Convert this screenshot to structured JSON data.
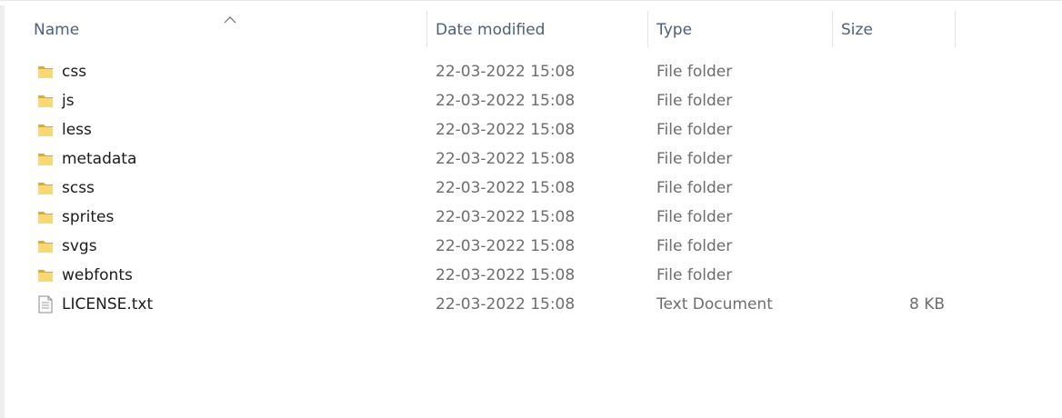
{
  "columns": {
    "name": "Name",
    "date_modified": "Date modified",
    "type": "Type",
    "size": "Size"
  },
  "sort": {
    "column": "name",
    "direction": "ascending"
  },
  "files": [
    {
      "name": "css",
      "date_modified": "22-03-2022 15:08",
      "type": "File folder",
      "size": "",
      "icon": "folder-icon"
    },
    {
      "name": "js",
      "date_modified": "22-03-2022 15:08",
      "type": "File folder",
      "size": "",
      "icon": "folder-icon"
    },
    {
      "name": "less",
      "date_modified": "22-03-2022 15:08",
      "type": "File folder",
      "size": "",
      "icon": "folder-icon"
    },
    {
      "name": "metadata",
      "date_modified": "22-03-2022 15:08",
      "type": "File folder",
      "size": "",
      "icon": "folder-icon"
    },
    {
      "name": "scss",
      "date_modified": "22-03-2022 15:08",
      "type": "File folder",
      "size": "",
      "icon": "folder-icon"
    },
    {
      "name": "sprites",
      "date_modified": "22-03-2022 15:08",
      "type": "File folder",
      "size": "",
      "icon": "folder-icon"
    },
    {
      "name": "svgs",
      "date_modified": "22-03-2022 15:08",
      "type": "File folder",
      "size": "",
      "icon": "folder-icon"
    },
    {
      "name": "webfonts",
      "date_modified": "22-03-2022 15:08",
      "type": "File folder",
      "size": "",
      "icon": "folder-icon"
    },
    {
      "name": "LICENSE.txt",
      "date_modified": "22-03-2022 15:08",
      "type": "Text Document",
      "size": "8 KB",
      "icon": "text-document-icon"
    }
  ],
  "colors": {
    "header_text": "#4c607a",
    "name_text": "#1b1b1b",
    "detail_text": "#6d6d6d",
    "folder_yellow": "#f8d775",
    "folder_dark": "#e0a82e"
  }
}
